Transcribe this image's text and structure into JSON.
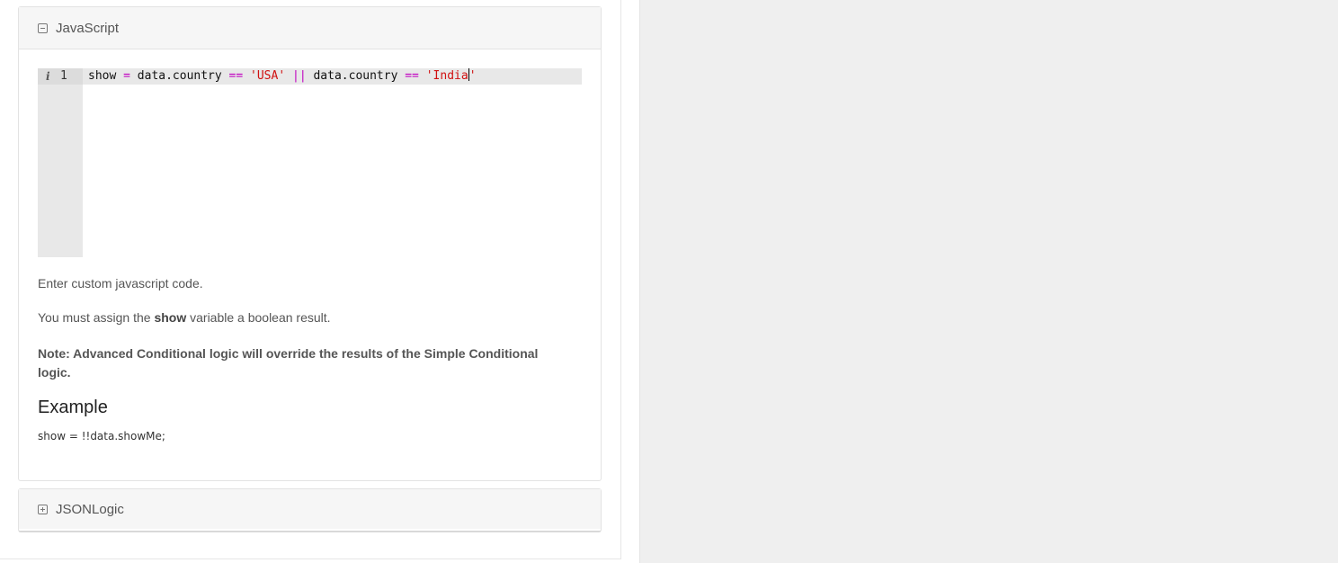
{
  "js_panel": {
    "title": "JavaScript",
    "toggle_icon": "minus-square-icon",
    "editor": {
      "info_icon": "i",
      "line_number": "1",
      "tokens": {
        "show": "show ",
        "eq": "=",
        "data1": " data.country ",
        "eqeq1": "==",
        "usa": " 'USA'",
        "or": " ||",
        "data2": " data.country ",
        "eqeq2": "==",
        "india": " 'India",
        "quote_end": "'"
      }
    },
    "help_line_1": "Enter custom javascript code.",
    "help_line_2_before": "You must assign the ",
    "help_line_2_bold": "show",
    "help_line_2_after": " variable a boolean result.",
    "note": "Note: Advanced Conditional logic will override the results of the Simple Conditional logic.",
    "example_heading": "Example",
    "example_code": "show = !!data.showMe;"
  },
  "jsonlogic_panel": {
    "title": "JSONLogic",
    "toggle_icon": "plus-square-icon"
  },
  "colors": {
    "operator": "#c000c0",
    "string": "#d01010",
    "panel_heading_bg": "#f6f6f6",
    "right_pane_bg": "#efefef"
  }
}
